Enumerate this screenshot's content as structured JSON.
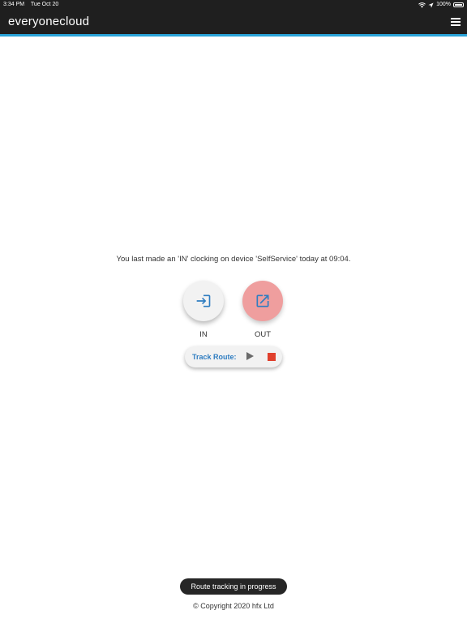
{
  "status_bar": {
    "time": "3:34 PM",
    "date": "Tue Oct 20",
    "battery": "100%",
    "icons": [
      "wifi-icon",
      "location-arrow-icon",
      "battery-icon"
    ]
  },
  "app_bar": {
    "title": "everyonecloud",
    "menu_icon": "hamburger-menu-icon",
    "background_color": "#1f1f1f",
    "accent_color": "#29a3d8"
  },
  "main": {
    "last_clocking_message": "You last made an 'IN' clocking on device 'SelfService' today at 09:04.",
    "clock_in": {
      "label": "IN",
      "icon": "sign-in-icon",
      "color": "#2f7dc1"
    },
    "clock_out": {
      "label": "OUT",
      "icon": "external-link-icon",
      "color": "#2f7dc1",
      "background": "#ef9e9e"
    },
    "track_route": {
      "label": "Track Route:",
      "play_icon": "play-icon",
      "stop_icon": "stop-icon",
      "stop_color": "#e0402d"
    }
  },
  "toast": {
    "text": "Route tracking in progress"
  },
  "footer": {
    "copyright": "© Copyright 2020 hfx Ltd"
  }
}
